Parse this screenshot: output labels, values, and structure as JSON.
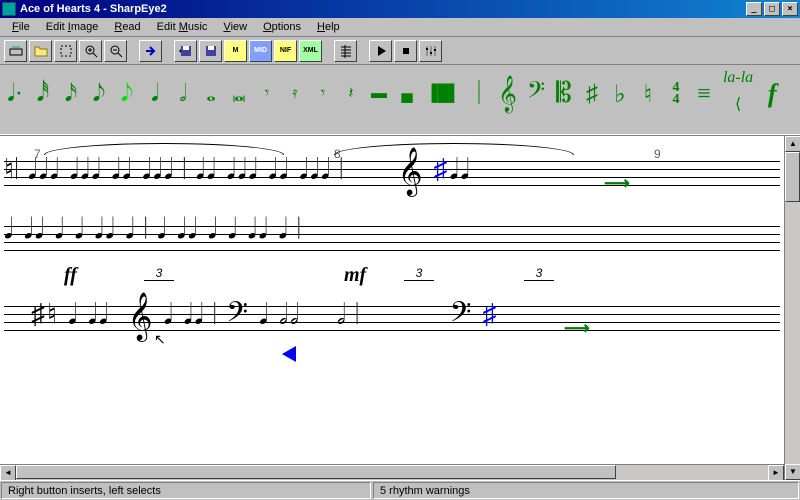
{
  "title": "Ace of Hearts 4 - SharpEye2",
  "menu": {
    "file": "File",
    "editimage": "Edit Image",
    "read": "Read",
    "editmusic": "Edit Music",
    "view": "View",
    "options": "Options",
    "help": "Help"
  },
  "toolbar": {
    "export_labels": {
      "m": "M",
      "mid": "MID",
      "nif": "NIF",
      "xml": "XML"
    }
  },
  "palette": {
    "lala": "la-la",
    "forte": "f",
    "timesig_top": "4",
    "timesig_bottom": "4"
  },
  "score": {
    "measures": {
      "m7": "7",
      "m8": "8",
      "m9": "9"
    },
    "dynamics": {
      "ff": "ff",
      "mf": "mf"
    },
    "tuplet": "3"
  },
  "status": {
    "left": "Right button inserts, left selects",
    "right": "5 rhythm warnings"
  }
}
